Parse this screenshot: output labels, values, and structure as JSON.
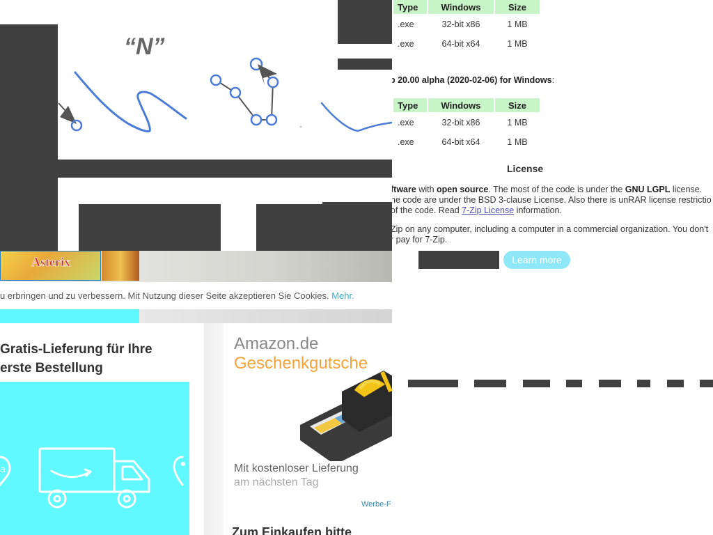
{
  "gesture": {
    "letter": "“N”"
  },
  "sevenzip": {
    "table_headers": [
      "Type",
      "Windows",
      "Size"
    ],
    "table1_rows": [
      {
        "type": ".exe",
        "windows": "32-bit x86",
        "size": "1 MB"
      },
      {
        "type": ".exe",
        "windows": "64-bit x64",
        "size": "1 MB"
      }
    ],
    "alpha_prefix": "p 20.00 alpha (2020-02-06) for Windows",
    "alpha_suffix": ":",
    "table2_rows": [
      {
        "type": ".exe",
        "windows": "32-bit x86",
        "size": "1 MB"
      },
      {
        "type": ".exe",
        "windows": "64-bit x64",
        "size": "1 MB"
      }
    ],
    "license_heading": "License",
    "license_p1_a": "ftware",
    "license_p1_b": " with ",
    "license_p1_c": "open source",
    "license_p1_d": ". The most of the code is under the ",
    "license_p1_e": "GNU LGPL",
    "license_p1_f": " license.",
    "license_p2": "he code are under the BSD 3-clause License. Also there is unRAR license restrictio",
    "license_p3_a": "of the code. Read ",
    "license_p3_link": "7-Zip License",
    "license_p3_b": " information.",
    "license_p4": "Zip on any computer, including a computer in a commercial organization. You don't",
    "license_p5": "r pay for 7-Zip.",
    "learn_more": "Learn more"
  },
  "amazon": {
    "cookie_text": "u erbringen und zu verbessern. Mit Nutzung dieser Seite akzeptieren Sie Cookies. ",
    "cookie_more": "Mehr.",
    "gratis_title": "Gratis-Lieferung für Ihre erste Bestellung",
    "gc_brand": "Amazon.de",
    "gc_product": "Geschenkgutsche",
    "gc_line1": "Mit kostenloser Lieferung",
    "gc_line2": "am nächsten Tag",
    "gc_ad": "Werbe-F",
    "shop_heading": "Zum Einkaufen bitte"
  },
  "colors": {
    "header_green": "#c8f5c8",
    "learn_more_bg": "#8ee8f8",
    "cyan": "#5ff7ff",
    "amazon_orange": "#f5a33a",
    "gesture_blue": "#4a7bd6",
    "overlay_dark": "#404040"
  }
}
